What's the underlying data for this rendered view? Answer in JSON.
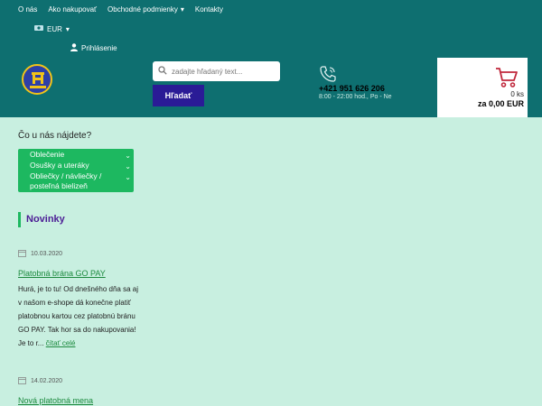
{
  "topnav": {
    "items": [
      "O nás",
      "Ako nakupovať",
      "Obchodné podmienky",
      "Kontakty"
    ]
  },
  "currency": {
    "label": "EUR"
  },
  "login": {
    "label": "Prihlásenie"
  },
  "search": {
    "placeholder": "zadajte hľadaný text...",
    "button": "Hľadať"
  },
  "contact": {
    "phone": "+421 951 626 206",
    "hours": "8:00 - 22:00 hod., Po - Ne"
  },
  "cart": {
    "count": "0 ks",
    "total": "za 0,00 EUR"
  },
  "categories": {
    "title": "Čo u nás nájdete?",
    "items": [
      "Oblečenie",
      "Osušky a uteráky",
      "Obliečky / návliečky / posteľná bielizeň"
    ]
  },
  "news": {
    "title": "Novinky",
    "posts": [
      {
        "date": "10.03.2020",
        "title": "Platobná brána GO PAY",
        "body": "Hurá, je to tu! Od dnešného dňa sa aj v našom e-shope dá konečne platiť platobnou kartou cez platobnú bránu GO PAY. Tak hor sa do nakupovania! Je to r...",
        "more": "čítať celé"
      },
      {
        "date": "14.02.2020",
        "title": "Nová platobná mena"
      }
    ]
  },
  "colors": {
    "teal": "#0e6f70",
    "mint": "#c8efe0",
    "green": "#1db860",
    "navy": "#2a1b96",
    "purple": "#4c1d95"
  }
}
